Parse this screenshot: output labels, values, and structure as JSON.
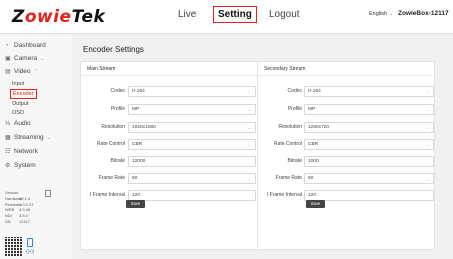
{
  "header": {
    "logo_prefix": "Z",
    "logo_mid": "owie",
    "logo_suffix": "Tek",
    "nav": {
      "live": "Live",
      "setting": "Setting",
      "logout": "Logout"
    },
    "language": "English",
    "device_name": "ZowieBox-12117"
  },
  "sidebar": {
    "items": {
      "dashboard": "Dashboard",
      "camera": "Camera",
      "video": "Video",
      "audio": "Audio",
      "streaming": "Streaming",
      "network": "Network",
      "system": "System"
    },
    "video_sub": [
      "Input",
      "Encoder",
      "Output",
      "OSD"
    ],
    "version": {
      "title": "Version",
      "rows": [
        [
          "Hardware",
          "20.1.4"
        ],
        [
          "Firmware",
          "1.0.2.37"
        ],
        [
          "WEB",
          "4.9.46"
        ],
        [
          "NDI",
          "3.5.4"
        ],
        [
          "SN",
          "12117"
        ]
      ]
    }
  },
  "page": {
    "title": "Encoder Settings"
  },
  "labels": {
    "codec": "Codec",
    "profile": "Profile",
    "resolution": "Resolution",
    "rate_control": "Rate Control",
    "bitrate": "Bitrate",
    "frame_rate": "Frame Rate",
    "iframe_interval": "I Frame Interval",
    "save": "Save"
  },
  "main_stream": {
    "title": "Main Stream",
    "codec": "H.264",
    "profile": "MP",
    "resolution": "1920x1080",
    "rate_control": "CBR",
    "bitrate": "12000",
    "frame_rate": "60",
    "iframe_interval": "120"
  },
  "secondary_stream": {
    "title": "Secondary Stream",
    "codec": "H.264",
    "profile": "MP",
    "resolution": "1280x720",
    "rate_control": "CBR",
    "bitrate": "1000",
    "frame_rate": "60",
    "iframe_interval": "120"
  },
  "colors": {
    "accent": "#e0231c",
    "save_button": "#444444"
  }
}
